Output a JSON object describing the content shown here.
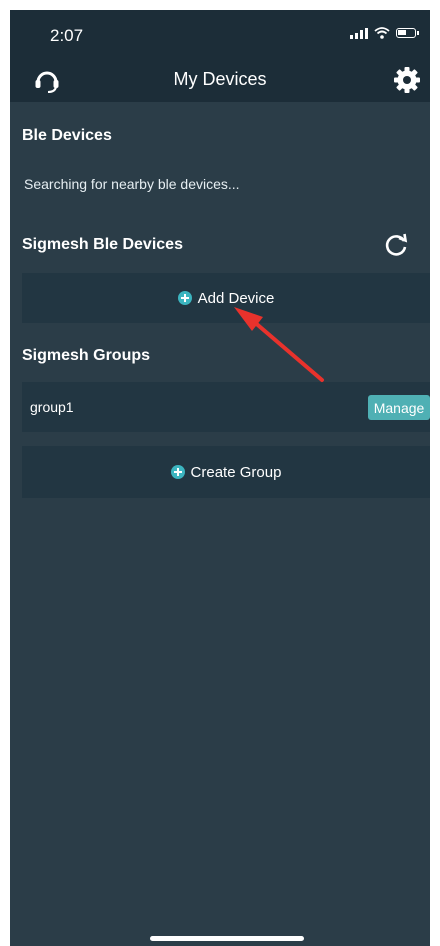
{
  "status_bar": {
    "time": "2:07"
  },
  "header": {
    "title": "My Devices",
    "left_icon": "headset-icon",
    "right_icon": "gear-icon"
  },
  "ble": {
    "title": "Ble Devices",
    "status": "Searching for nearby ble devices..."
  },
  "sigmesh_devices": {
    "title": "Sigmesh Ble Devices",
    "refresh_icon": "refresh-icon",
    "add_label": "Add Device"
  },
  "sigmesh_groups": {
    "title": "Sigmesh Groups",
    "groups": [
      {
        "name": "group1",
        "action": "Manage"
      }
    ],
    "create_label": "Create Group"
  },
  "colors": {
    "background": "#2b3d48",
    "header": "#1c2d38",
    "card": "#223642",
    "accent": "#3cb5c0",
    "annotation_arrow": "#e8322c"
  }
}
